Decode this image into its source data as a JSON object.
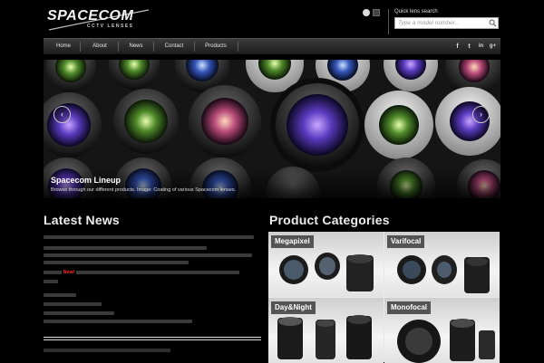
{
  "header": {
    "logo_text": "SPACECOM",
    "logo_sub": "CCTV LENSES",
    "quick_lens_label": "Quick lens search",
    "quick_lens_placeholder": "Type a model number..."
  },
  "nav": {
    "items": [
      {
        "label": "Home"
      },
      {
        "label": "About"
      },
      {
        "label": "News"
      },
      {
        "label": "Contact"
      },
      {
        "label": "Products"
      }
    ],
    "social": [
      "f",
      "t",
      "in",
      "g+"
    ]
  },
  "hero": {
    "title": "Spacecom Lineup",
    "subtitle": "Browse through our different products. Image: Coating of various Spacecom lenses.",
    "prev_glyph": "‹",
    "next_glyph": "›"
  },
  "left": {
    "title": "Latest News",
    "highlight": "New!"
  },
  "right": {
    "title": "Product Categories",
    "categories": [
      {
        "label": "Megapixel"
      },
      {
        "label": "Varifocal"
      },
      {
        "label": "Day&Night"
      },
      {
        "label": "Monofocal"
      }
    ]
  },
  "colors": {
    "accent_red": "#ff2a2a",
    "background": "#000000",
    "navbar": "#2a2a2a"
  }
}
